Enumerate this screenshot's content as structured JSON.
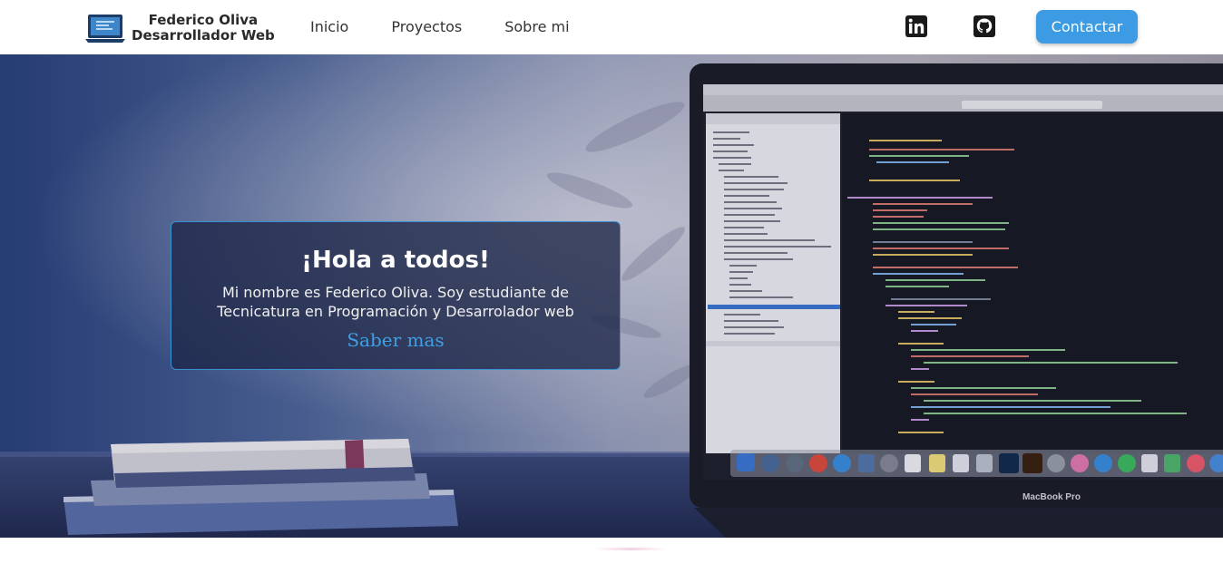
{
  "brand": {
    "name": "Federico Oliva",
    "role": "Desarrollador Web",
    "logo_icon": "laptop-icon"
  },
  "nav": {
    "links": [
      {
        "label": "Inicio"
      },
      {
        "label": "Proyectos"
      },
      {
        "label": "Sobre mi"
      }
    ],
    "social": [
      {
        "icon": "linkedin-icon"
      },
      {
        "icon": "github-icon"
      }
    ],
    "contact_label": "Contactar"
  },
  "hero": {
    "title": "¡Hola a todos!",
    "text": "Mi nombre es Federico Oliva. Soy estudiante de Tecnicatura en Programación y Desarrolador web",
    "link_label": "Saber mas",
    "laptop_label": "MacBook Pro"
  },
  "colors": {
    "accent": "#3c9be2",
    "card_border": "#3c8fd0",
    "link": "#3f9fe6",
    "hero_overlay": "#1c2546"
  }
}
